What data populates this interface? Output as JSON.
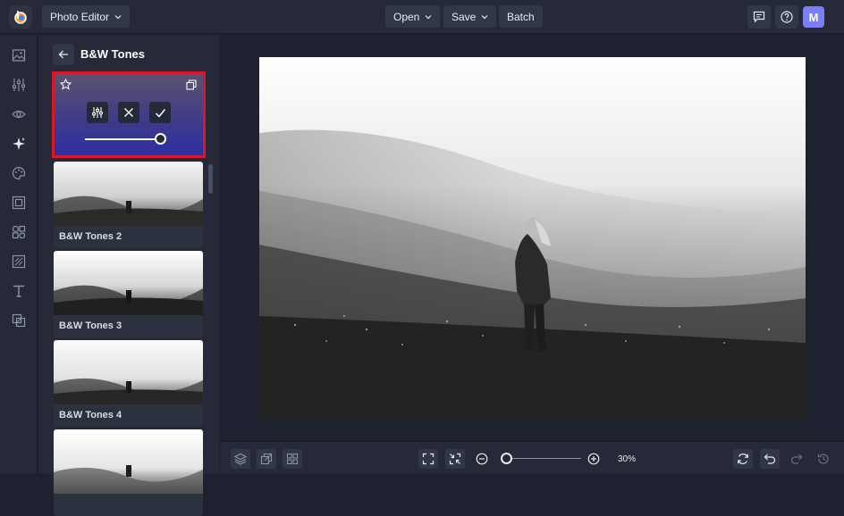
{
  "header": {
    "app_menu_label": "Photo Editor",
    "open_label": "Open",
    "save_label": "Save",
    "batch_label": "Batch",
    "avatar_initial": "M"
  },
  "rail": {
    "items": [
      "image-icon",
      "adjustments-icon",
      "eye-icon",
      "effects-icon",
      "palette-icon",
      "frame-icon",
      "shapes-icon",
      "overlay-icon",
      "text-icon",
      "background-icon"
    ],
    "active_index": 3
  },
  "panel": {
    "title": "B&W Tones",
    "active_preset": {
      "intensity": 1.0
    },
    "presets": [
      {
        "label": "B&W Tones 2"
      },
      {
        "label": "B&W Tones 3"
      },
      {
        "label": "B&W Tones 4"
      },
      {
        "label": ""
      }
    ]
  },
  "footer": {
    "zoom_level": "30%",
    "zoom_fraction": 0.05
  },
  "colors": {
    "accent": "#7b7ff5",
    "selection_border": "#d9162a",
    "panel_bg": "#262a38",
    "canvas_bg": "#1e2230"
  }
}
